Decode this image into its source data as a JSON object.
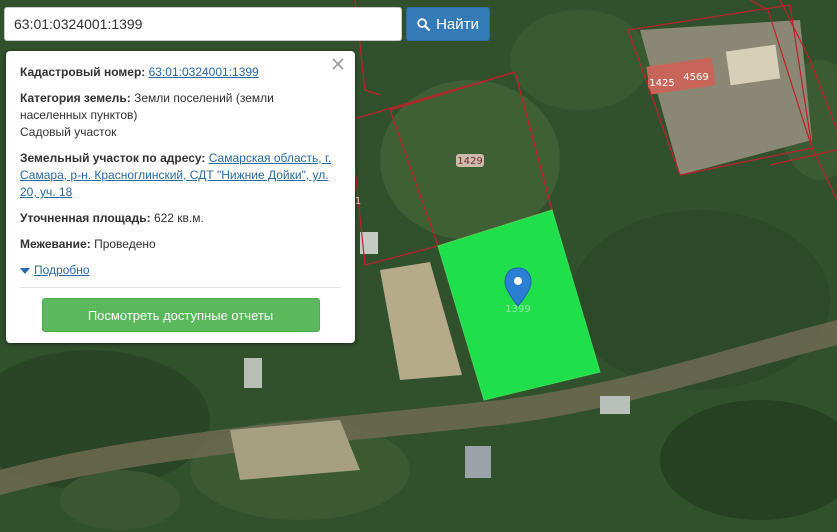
{
  "search": {
    "value": "63:01:0324001:1399",
    "button_label": "Найти"
  },
  "popup": {
    "cadastral_label": "Кадастровый номер:",
    "cadastral_value": "63:01:0324001:1399",
    "category_label": "Категория земель:",
    "category_value": "Земли поселений (земли населенных пунктов)",
    "category_sub": "Садовый участок",
    "address_label": "Земельный участок по адресу:",
    "address_value": "Самарская область, г. Самара, р-н. Красноглинский, СДТ \"Нижние Дойки\", ул. 20, уч. 18",
    "area_label": "Уточненная площадь:",
    "area_value": "622 кв.м.",
    "survey_label": "Межевание:",
    "survey_value": "Проведено",
    "more_label": "Подробно",
    "reports_button": "Посмотреть доступные отчеты"
  },
  "map": {
    "parcel_labels": [
      "1425",
      "4569",
      "1429",
      "1399",
      "1"
    ],
    "highlight_color": "#1fe04a",
    "boundary_color": "#c0202a"
  },
  "icons": {
    "search": "search-icon",
    "close": "close-icon",
    "marker": "map-marker-icon",
    "caret": "caret-down-icon"
  }
}
